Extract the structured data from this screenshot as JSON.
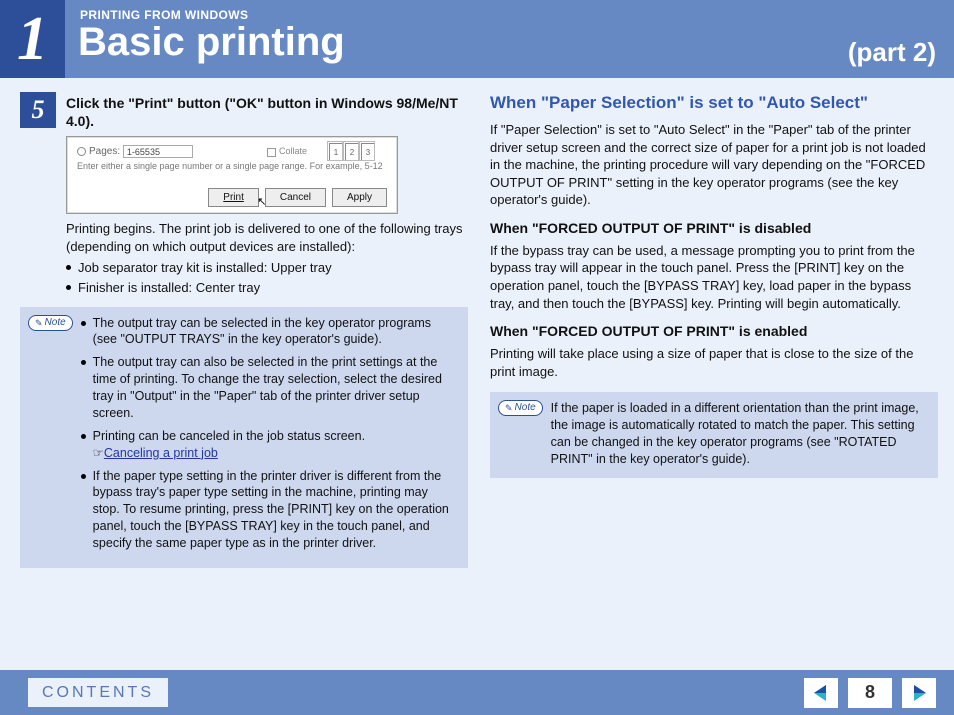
{
  "header": {
    "chapter_number": "1",
    "kicker": "PRINTING FROM WINDOWS",
    "title": "Basic printing",
    "part": "(part 2)"
  },
  "left": {
    "step_number": "5",
    "step_title": "Click the \"Print\" button (\"OK\" button in Windows 98/Me/NT 4.0).",
    "dialog": {
      "pages_label": "Pages:",
      "pages_value": "1-65535",
      "hint": "Enter either a single page number or a single page range. For example, 5-12",
      "collate_label": "Collate",
      "page1": "1",
      "page2": "2",
      "page3": "3",
      "print_btn": "Print",
      "cancel_btn": "Cancel",
      "apply_btn": "Apply"
    },
    "after_step_text": "Printing begins. The print job is delivered to one of the following trays (depending on which output devices are installed):",
    "tray_bullets": [
      "Job separator tray kit is installed: Upper tray",
      "Finisher is installed: Center tray"
    ],
    "note_label": "Note",
    "note_items": {
      "a": "The output tray can be selected in the key operator programs (see \"OUTPUT TRAYS\" in the key operator's guide).",
      "b": "The output tray can also be selected in the print settings at the time of printing. To change the tray selection, select the desired tray in \"Output\" in the \"Paper\" tab of the printer driver setup screen.",
      "c": "Printing can be canceled in the job status screen.",
      "c_link": "Canceling a print job",
      "d": "If the paper type setting in the printer driver is different from the bypass tray's paper type setting in the machine, printing may stop. To resume printing, press the [PRINT] key on the operation panel, touch the [BYPASS TRAY] key in the touch panel, and specify the same paper type as in the printer driver."
    }
  },
  "right": {
    "h2": "When \"Paper Selection\" is set to \"Auto Select\"",
    "p1": "If \"Paper Selection\" is set to \"Auto Select\" in the \"Paper\" tab of the printer driver setup screen and the correct size of paper for a print job is not loaded in the machine, the printing procedure will vary depending on the \"FORCED OUTPUT OF PRINT\" setting in the key operator programs (see the key operator's guide).",
    "h3a": "When \"FORCED OUTPUT OF PRINT\" is disabled",
    "p2": "If the bypass tray can be used, a message prompting you to print from the bypass tray will appear in the touch panel. Press the [PRINT] key on the operation panel, touch the [BYPASS TRAY] key, load paper in the bypass tray, and then touch the [BYPASS] key. Printing will begin automatically.",
    "h3b": "When \"FORCED OUTPUT OF PRINT\" is enabled",
    "p3": "Printing will take place using a size of paper that is close to the size of the print image.",
    "note_label": "Note",
    "note_text": "If the paper is loaded in a different orientation than the print image, the image is automatically rotated to match the paper. This setting can be changed in the key operator programs (see \"ROTATED PRINT\" in the key operator's guide)."
  },
  "footer": {
    "contents": "CONTENTS",
    "page_number": "8"
  }
}
